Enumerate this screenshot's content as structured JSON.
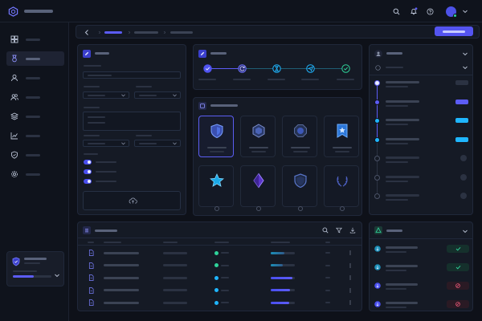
{
  "app": {
    "logo_icon": "hexagon-logo-icon",
    "accent": "#5c5cf6",
    "success": "#2fd39a",
    "warning": "#f05a7a",
    "info": "#1fb6ff"
  },
  "topbar": {
    "search_icon": "search-icon",
    "notifications_icon": "bell-icon",
    "help_icon": "help-circle-icon",
    "avatar_icon": "avatar-icon",
    "chevron_icon": "chevron-down-icon"
  },
  "sidebar": {
    "items": [
      {
        "icon": "grid-icon"
      },
      {
        "icon": "badge-icon",
        "active": true
      },
      {
        "icon": "user-icon"
      },
      {
        "icon": "users-icon"
      },
      {
        "icon": "layers-icon"
      },
      {
        "icon": "chart-icon"
      },
      {
        "icon": "shield-icon"
      },
      {
        "icon": "gear-icon"
      }
    ],
    "footer": {
      "icon": "shield-badge-icon",
      "progress": 0.55
    }
  },
  "stepper": {
    "steps": [
      {
        "icon": "check-icon",
        "state": "done"
      },
      {
        "icon": "refresh-icon",
        "state": "active"
      },
      {
        "icon": "hourglass-icon",
        "state": "pending"
      },
      {
        "icon": "send-icon",
        "state": "pending"
      },
      {
        "icon": "check-icon",
        "state": "pending"
      }
    ]
  },
  "badges": {
    "header_icon": "badge-grid-icon",
    "tiles": [
      {
        "icon": "shield-badge-icon",
        "selected": true
      },
      {
        "icon": "hex-badge-icon"
      },
      {
        "icon": "octagon-badge-icon"
      },
      {
        "icon": "ribbon-badge-icon"
      },
      {
        "icon": "star-badge-icon"
      },
      {
        "icon": "diamond-badge-icon"
      },
      {
        "icon": "shield-outline-icon"
      },
      {
        "icon": "laurel-icon"
      }
    ]
  },
  "table": {
    "header_icon": "list-icon",
    "rows": [
      {
        "status": "#2fd39a",
        "progress": 0.55
      },
      {
        "status": "#2fd39a",
        "progress": 0.5
      },
      {
        "status": "#1fb6ff",
        "progress": 0.9
      },
      {
        "status": "#1fb6ff",
        "progress": 0.8
      },
      {
        "status": "#1fb6ff",
        "progress": 0.75
      }
    ]
  },
  "timeline": {
    "items": [
      {
        "state": "current",
        "tag": "none"
      },
      {
        "state": "done",
        "tag": "accent"
      },
      {
        "state": "done",
        "tag": "info"
      },
      {
        "state": "done",
        "tag": "info"
      },
      {
        "state": "pending",
        "tag": "dot"
      },
      {
        "state": "pending",
        "tag": "dot"
      },
      {
        "state": "pending",
        "tag": "dot"
      }
    ]
  },
  "approvals": {
    "header_icon": "users-group-icon",
    "items": [
      {
        "status": "approved"
      },
      {
        "status": "approved"
      },
      {
        "status": "rejected"
      },
      {
        "status": "rejected"
      }
    ]
  }
}
